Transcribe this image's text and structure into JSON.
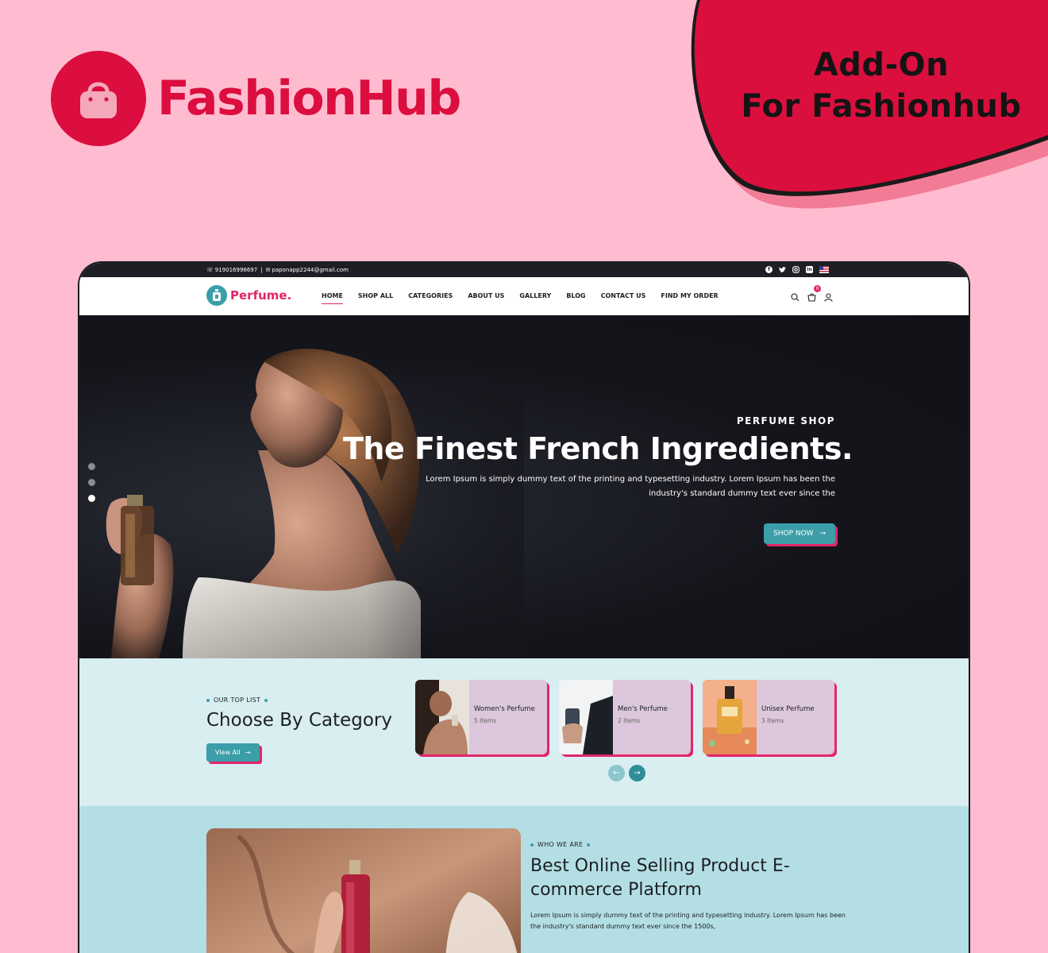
{
  "promo": {
    "brand_name": "FashionHub",
    "addon_line1": "Add-On",
    "addon_line2": "For Fashionhub",
    "colors": {
      "background": "#ffbcd0",
      "brand": "#db0e3f",
      "brand_light": "#f4a9bb"
    }
  },
  "site": {
    "topbar": {
      "phone": "919016996697",
      "email": "paponapp2244@gmail.com",
      "social_icons": [
        "facebook-icon",
        "twitter-icon",
        "instagram-icon",
        "linkedin-icon",
        "us-flag-icon"
      ]
    },
    "logo_text": "Perfume.",
    "nav": [
      {
        "label": "HOME",
        "active": true
      },
      {
        "label": "SHOP ALL"
      },
      {
        "label": "CATEGORIES"
      },
      {
        "label": "ABOUT US"
      },
      {
        "label": "GALLERY"
      },
      {
        "label": "BLOG"
      },
      {
        "label": "CONTACT US"
      },
      {
        "label": "FIND MY ORDER"
      }
    ],
    "cart_count": "0",
    "colors": {
      "accent": "#e4256b",
      "teal": "#3b9ea8"
    },
    "hero": {
      "eyebrow": "PERFUME SHOP",
      "title": "The Finest French Ingredients.",
      "subtitle": "Lorem Ipsum is simply dummy text of the printing and typesetting industry. Lorem Ipsum has been the industry's standard dummy text ever since the",
      "button": "SHOP NOW",
      "slide_count": 3,
      "active_slide": 3
    },
    "categories": {
      "eyebrow": "OUR TOP LIST",
      "title": "Choose By Category",
      "button": "View All",
      "items": [
        {
          "name": "Women's Perfume",
          "count": "5 Items"
        },
        {
          "name": "Men's Perfume",
          "count": "2 Items"
        },
        {
          "name": "Unisex Perfume",
          "count": "3 Items"
        }
      ]
    },
    "about": {
      "eyebrow": "WHO WE ARE",
      "title": "Best Online Selling Product E-commerce Platform",
      "text": "Lorem Ipsum is simply dummy text of the printing and typesetting industry. Lorem Ipsum has been the industry's standard dummy text ever since the 1500s,"
    }
  }
}
